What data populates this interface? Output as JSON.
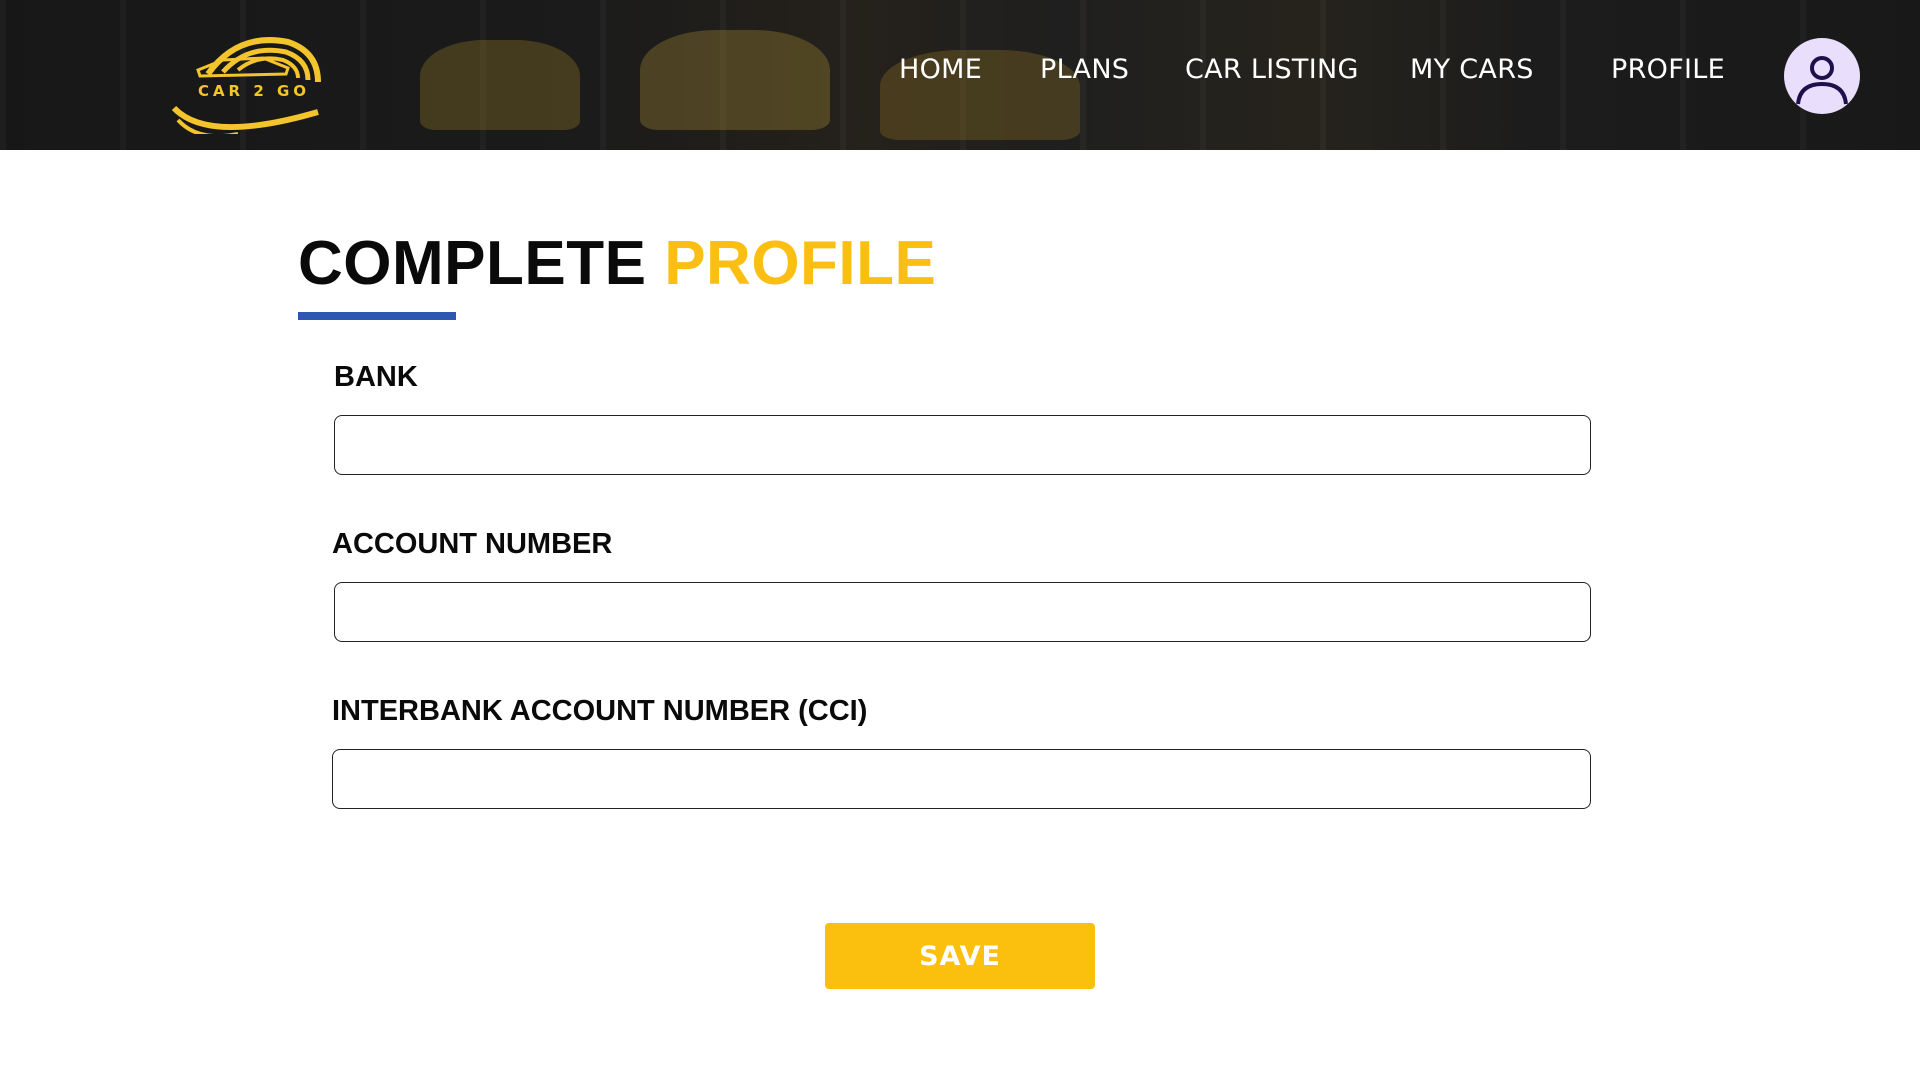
{
  "brand": {
    "logo_text": "CAR 2 GO",
    "accent_color": "#f3c42c"
  },
  "nav": {
    "items": [
      {
        "label": "HOME"
      },
      {
        "label": "PLANS"
      },
      {
        "label": "CAR LISTING"
      },
      {
        "label": "MY CARS"
      },
      {
        "label": "PROFILE"
      }
    ],
    "avatar_icon": "user-icon"
  },
  "main": {
    "title_part1": "COMPLETE ",
    "title_part2": "PROFILE",
    "title_accent_color": "#fbbf14",
    "underline_color": "#2e57b1",
    "fields": [
      {
        "label": "BANK",
        "value": "",
        "placeholder": ""
      },
      {
        "label": "ACCOUNT NUMBER",
        "value": "",
        "placeholder": ""
      },
      {
        "label": "INTERBANK ACCOUNT NUMBER (CCI)",
        "value": "",
        "placeholder": ""
      }
    ],
    "save_label": "SAVE",
    "save_color": "#fbbf0d"
  }
}
